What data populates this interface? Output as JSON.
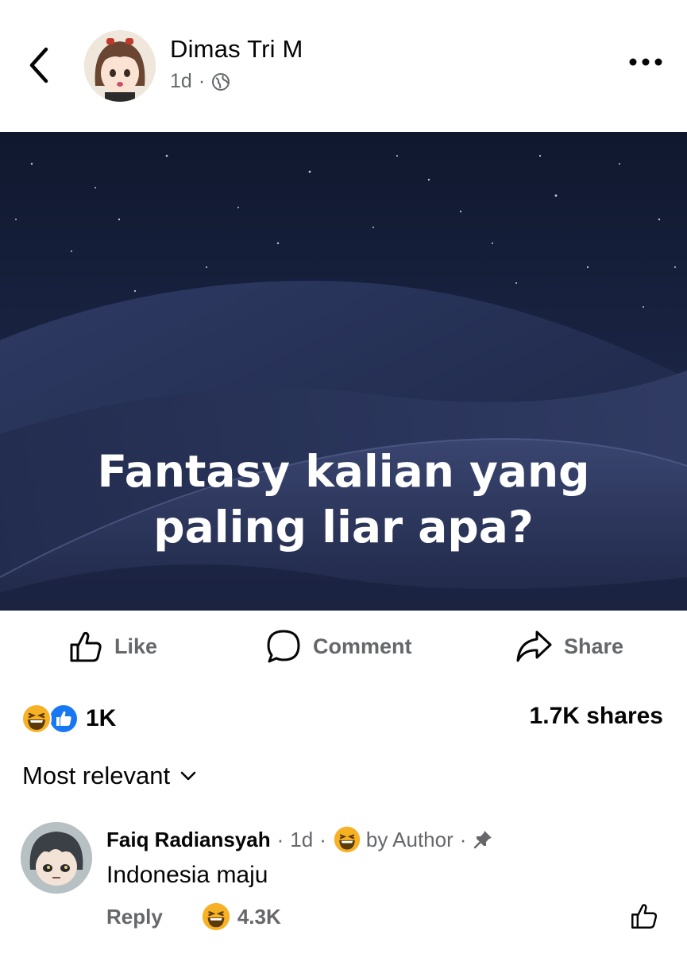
{
  "header": {
    "author": "Dimas Tri M",
    "time": "1d",
    "separator": "·",
    "privacy_icon": "globe-icon"
  },
  "post": {
    "text_line1": "Fantasy kalian yang",
    "text_line2": "paling liar apa?",
    "background_colors": [
      "#1f2a4a",
      "#141d38",
      "#2b3459"
    ]
  },
  "actions": {
    "like": "Like",
    "comment": "Comment",
    "share": "Share"
  },
  "reactions": {
    "icons": [
      "laugh-emoji-icon",
      "like-reaction-icon"
    ],
    "count": "1K",
    "shares": "1.7K shares"
  },
  "sort": {
    "label": "Most relevant"
  },
  "comment": {
    "name": "Faiq Radiansyah",
    "time": "1d",
    "author_reaction": "by Author",
    "text": "Indonesia maju",
    "reply": "Reply",
    "reaction_count": "4.3K",
    "pinned_icon": "pin-icon"
  },
  "colors": {
    "secondary_text": "#65676b",
    "like_blue": "#1877f2",
    "emoji_yellow": "#f7b125"
  }
}
